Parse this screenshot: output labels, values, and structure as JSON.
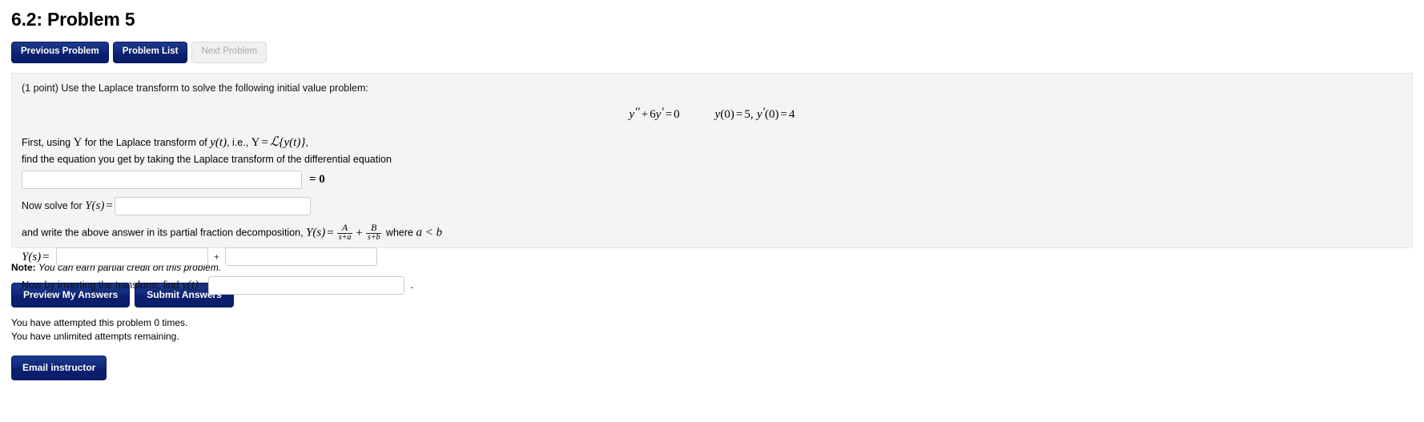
{
  "page_title": "6.2: Problem 5",
  "nav": {
    "previous_label": "Previous Problem",
    "problem_list_label": "Problem List",
    "next_label": "Next Problem"
  },
  "problem": {
    "points_prompt": "(1 point) Use the Laplace transform to solve the following initial value problem:",
    "equation": {
      "ode_y": "y",
      "ode_dprime": "′′",
      "ode_plus": "+",
      "ode_coef": "6",
      "ode_y2": "y",
      "ode_prime": "′",
      "ode_equals": "=",
      "ode_rhs": "0",
      "ic_y1": "y",
      "ic_open1": "(0)",
      "ic_eq1": "=",
      "ic_val1": "5,",
      "ic_y2": "y",
      "ic_prime2": "′",
      "ic_open2": "(0)",
      "ic_eq2": "=",
      "ic_val2": "4"
    },
    "first_line_a": "First, using ",
    "first_line_Y": "Y",
    "first_line_b": " for the Laplace transform of ",
    "first_line_yt": "y(t)",
    "first_line_c": ", i.e., ",
    "first_line_Y2": "Y",
    "first_line_eq": "=",
    "first_line_L": "ℒ",
    "first_line_brace": "{y(t)}",
    "first_line_comma": ",",
    "second_line": "find the equation you get by taking the Laplace transform of the differential equation",
    "eq_input_value": "",
    "eq_zero_label": "= 0",
    "now_solve_label_a": "Now solve for ",
    "now_solve_Ys": "Y(s)",
    "now_solve_eq": "=",
    "ys_input_value": "",
    "pf_line_a": "and write the above answer in its partial fraction decomposition, ",
    "pf_Ys": "Y(s)",
    "pf_eq": "=",
    "pf_num_A": "A",
    "pf_den_a": "s+a",
    "pf_plus": "+",
    "pf_num_B": "B",
    "pf_den_b": "s+b",
    "pf_where": " where ",
    "pf_cond": "a < b",
    "ys_row_label": "Y(s)",
    "ys_row_eq": "=",
    "pf_input_1": "",
    "pf_plus_sep": "+",
    "pf_input_2": "",
    "invert_line_a": "Now by inverting the transform, find ",
    "invert_yt": "y(t)",
    "invert_eq": "=",
    "invert_input": "",
    "invert_period": "."
  },
  "footer": {
    "note_label": "Note:",
    "note_text": "You can earn partial credit on this problem.",
    "preview_label": "Preview My Answers",
    "submit_label": "Submit Answers",
    "attempted_text": "You have attempted this problem 0 times.",
    "remaining_text": "You have unlimited attempts remaining.",
    "email_label": "Email instructor"
  },
  "colors": {
    "button_primary": "#0c2070",
    "panel_background": "#f4f4f4",
    "panel_border": "#e4e4e4",
    "disabled_text": "#a9a9a9"
  }
}
